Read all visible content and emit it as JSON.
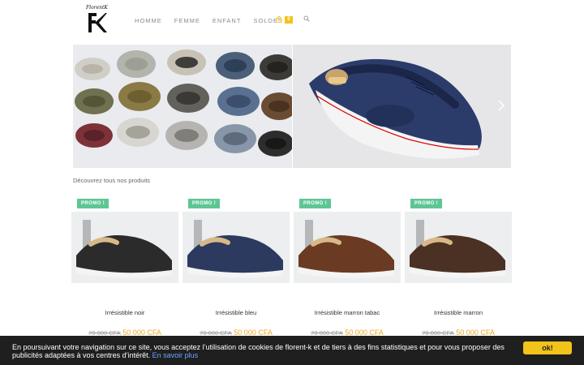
{
  "logo": {
    "script_text": "FlorentK"
  },
  "nav": {
    "items": [
      "HOMME",
      "FEMME",
      "ENFANT",
      "SOLDES"
    ]
  },
  "cart": {
    "count": "0"
  },
  "intro": "Découvrez tous nos produits",
  "products": [
    {
      "badge": "PROMO !",
      "name": "Irrésistible noir",
      "old_price": "70 000 CFA",
      "new_price": "50 000 CFA",
      "color": "#2b2b2b"
    },
    {
      "badge": "PROMO !",
      "name": "Irrésistible bleu",
      "old_price": "70 000 CFA",
      "new_price": "50 000 CFA",
      "color": "#2b3a5e"
    },
    {
      "badge": "PROMO !",
      "name": "Irrésistible marron tabac",
      "old_price": "70 000 CFA",
      "new_price": "50 000 CFA",
      "color": "#6b3a22"
    },
    {
      "badge": "PROMO !",
      "name": "Irrésistible marron",
      "old_price": "70 000 CFA",
      "new_price": "50 000 CFA",
      "color": "#4a3124"
    }
  ],
  "cookie": {
    "text": "En poursuivant votre navigation sur ce site, vous acceptez l’utilisation de cookies de florent-k et de tiers à des fins statistiques et pour vous proposer des publicités adaptées à vos centres d’intérêt.",
    "link": "En savoir plus",
    "ok": "ok!"
  },
  "colors": {
    "accent": "#f2c318",
    "promo": "#5ec694",
    "price": "#e8a71e",
    "cookie_bg": "#1f1f1f"
  },
  "icons": {
    "cart": "shopping-bag-icon",
    "search": "search-icon",
    "next": "chevron-right-icon"
  }
}
